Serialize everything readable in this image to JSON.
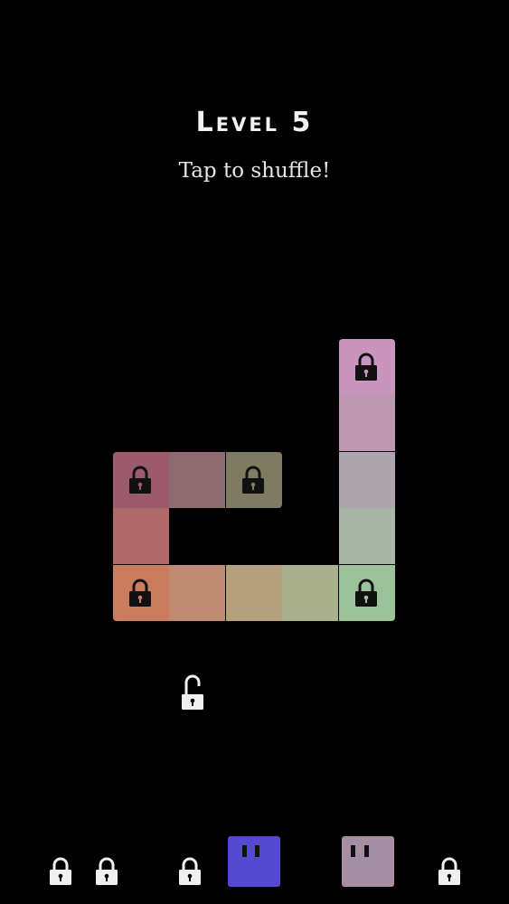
{
  "header": {
    "title": "Level 5",
    "subtitle": "Tap to shuffle!"
  },
  "board": {
    "tiles": [
      {
        "id": "r0c4",
        "color": "#c994be",
        "locked": true
      },
      {
        "id": "r1c4",
        "color": "#bb98b0",
        "locked": false
      },
      {
        "id": "r2c0",
        "color": "#9b5a6e",
        "locked": true
      },
      {
        "id": "r2c1",
        "color": "#8e6b6e",
        "locked": false
      },
      {
        "id": "r2c2",
        "color": "#7d7c63",
        "locked": true
      },
      {
        "id": "r2c4",
        "color": "#aea6ad",
        "locked": false
      },
      {
        "id": "r3c0",
        "color": "#b06a6a",
        "locked": false
      },
      {
        "id": "r3c4",
        "color": "#a7b6a6",
        "locked": false
      },
      {
        "id": "r4c0",
        "color": "#cc7c5e",
        "locked": true
      },
      {
        "id": "r4c1",
        "color": "#bf8c73",
        "locked": false
      },
      {
        "id": "r4c2",
        "color": "#b5a07e",
        "locked": false
      },
      {
        "id": "r4c3",
        "color": "#a9b08b",
        "locked": false
      },
      {
        "id": "r4c4",
        "color": "#9cc29a",
        "locked": true
      }
    ],
    "lock_icon": "lock-icon",
    "unlock_icon": "unlock-icon"
  },
  "tray": {
    "cards": [
      {
        "id": "blue",
        "color": "#5549d1"
      },
      {
        "id": "mauve",
        "color": "#a58da3"
      }
    ],
    "lock_color": "#f0f0f0"
  }
}
